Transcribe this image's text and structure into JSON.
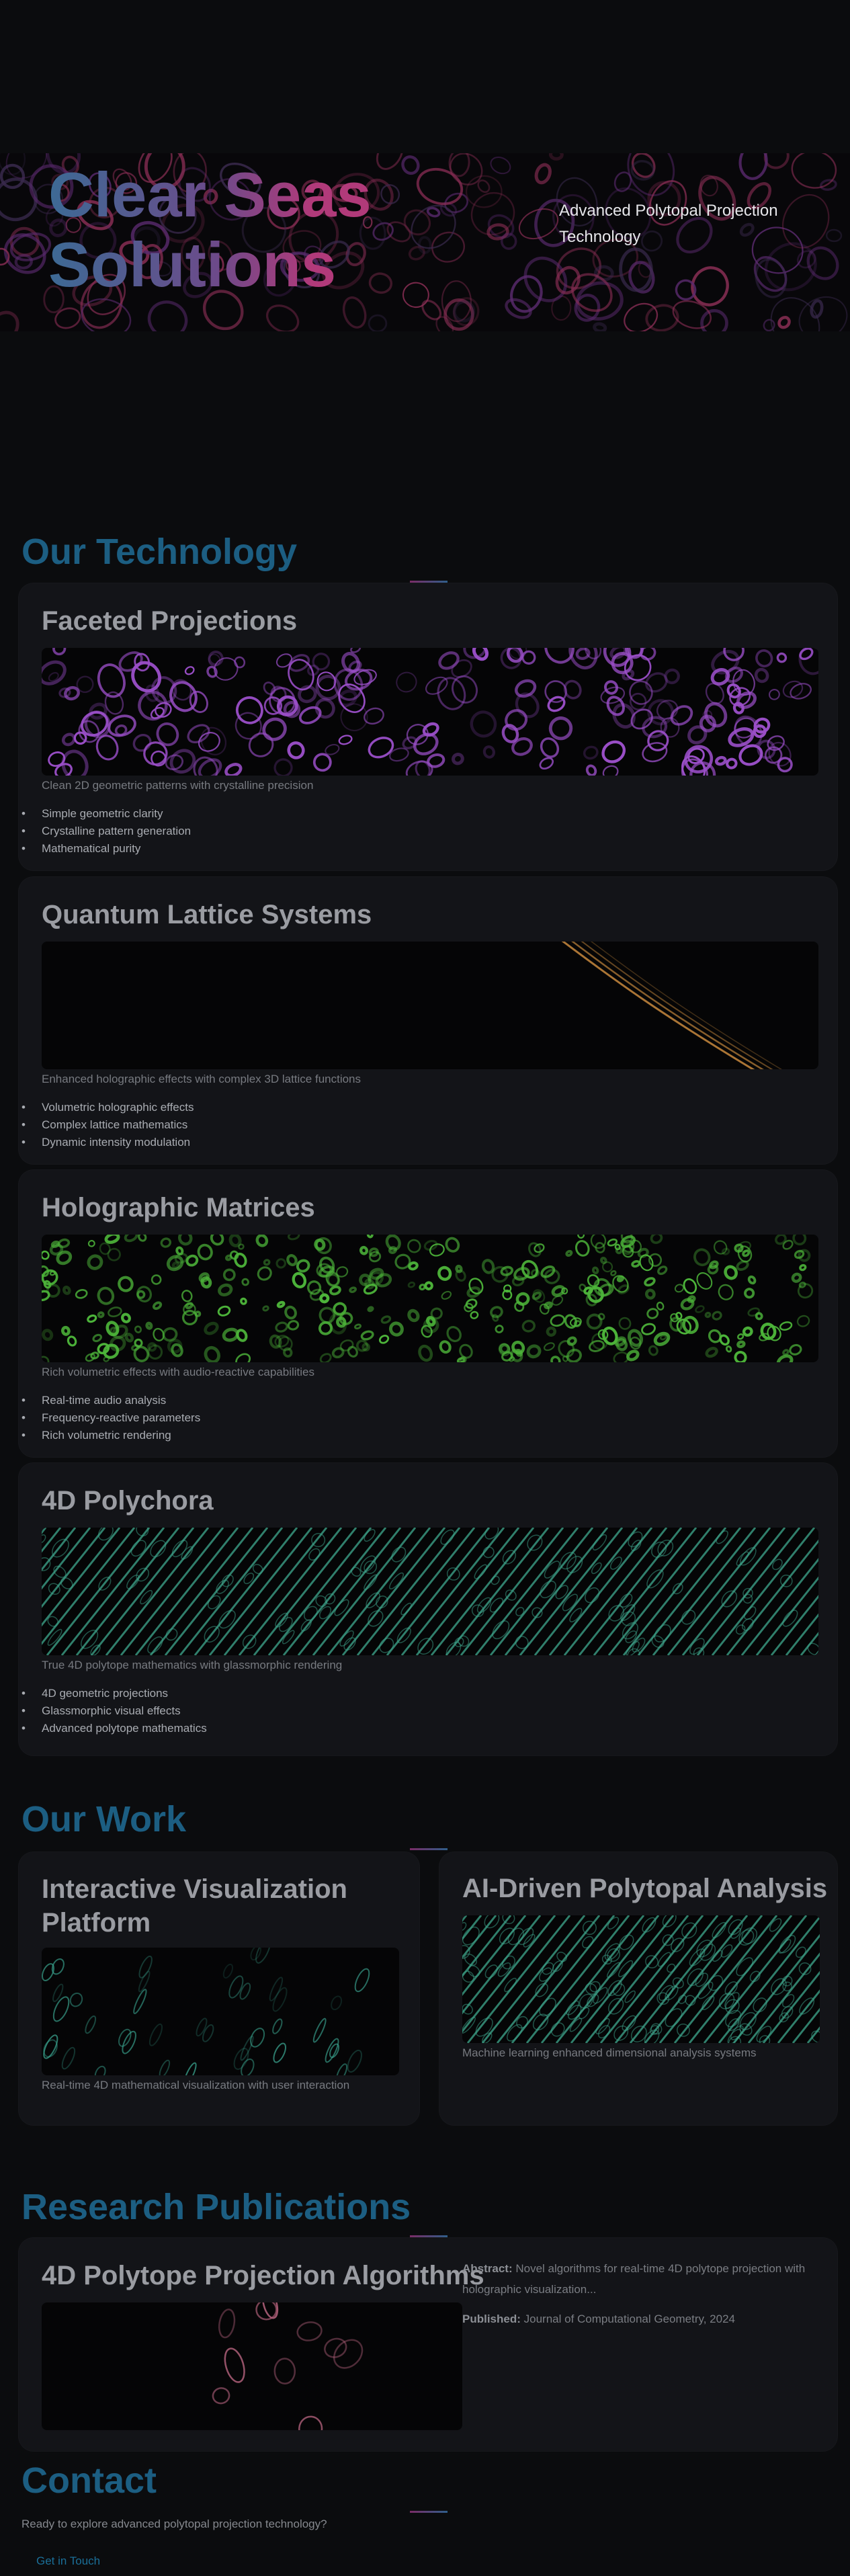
{
  "hero": {
    "title": "Clear Seas Solutions",
    "subtitle": "Advanced Polytopal Projection Technology"
  },
  "technology": {
    "heading": "Our Technology",
    "cards": [
      {
        "title": "Faceted Projections",
        "description": "Clean 2D geometric patterns with crystalline precision",
        "features": [
          "Simple geometric clarity",
          "Crystalline pattern generation",
          "Mathematical purity"
        ],
        "accent": "#9b4fc9"
      },
      {
        "title": "Quantum Lattice Systems",
        "description": "Enhanced holographic effects with complex 3D lattice functions",
        "features": [
          "Volumetric holographic effects",
          "Complex lattice mathematics",
          "Dynamic intensity modulation"
        ],
        "accent": "#c98a3e"
      },
      {
        "title": "Holographic Matrices",
        "description": "Rich volumetric effects with audio-reactive capabilities",
        "features": [
          "Real-time audio analysis",
          "Frequency-reactive parameters",
          "Rich volumetric rendering"
        ],
        "accent": "#4db53a"
      },
      {
        "title": "4D Polychora",
        "description": "True 4D polytope mathematics with glassmorphic rendering",
        "features": [
          "4D geometric projections",
          "Glassmorphic visual effects",
          "Advanced polytope mathematics"
        ],
        "accent": "#3fa88e"
      }
    ]
  },
  "work": {
    "heading": "Our Work",
    "cards": [
      {
        "title": "Interactive Visualization Platform",
        "description": "Real-time 4D mathematical visualization with user interaction",
        "accent": "#3aa590"
      },
      {
        "title": "AI-Driven Polytopal Analysis",
        "description": "Machine learning enhanced dimensional analysis systems",
        "accent": "#3fa88e"
      }
    ]
  },
  "research": {
    "heading": "Research Publications",
    "publication": {
      "title": "4D Polytope Projection Algorithms",
      "abstract_label": "Abstract:",
      "abstract": "Novel algorithms for real-time 4D polytope projection with holographic visualization...",
      "published_label": "Published:",
      "published": "Journal of Computational Geometry, 2024",
      "accent": "#b0607a"
    }
  },
  "contact": {
    "heading": "Contact",
    "text": "Ready to explore advanced polytopal projection technology?",
    "button": "Get in Touch"
  }
}
